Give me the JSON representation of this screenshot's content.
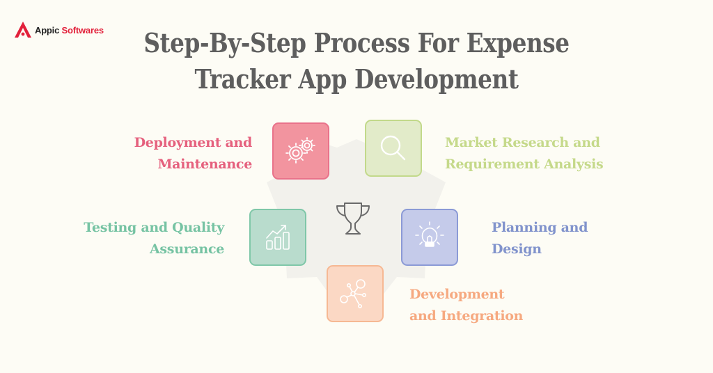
{
  "brand": {
    "name_part1": "Appic",
    "name_part2": "Softwares",
    "logo_icon": "triangle-a-logo",
    "color": "#e2203a"
  },
  "title": {
    "line1": "Step-By-Step Process For Expense",
    "line2": "Tracker App Development"
  },
  "center": {
    "icon": "trophy-icon"
  },
  "steps": [
    {
      "id": "market-research",
      "label_line1": "Market Research and",
      "label_line2": "Requirement Analysis",
      "icon": "search-icon",
      "color": "#c5d98a",
      "fill": "#e2ebc9",
      "border": "#c2d98a"
    },
    {
      "id": "planning-design",
      "label_line1": "Planning and",
      "label_line2": "Design",
      "icon": "lightbulb-icon",
      "color": "#8193cc",
      "fill": "#c5cbea",
      "border": "#8b9ad6"
    },
    {
      "id": "development-integration",
      "label_line1": "Development",
      "label_line2": "and Integration",
      "icon": "network-icon",
      "color": "#f6a980",
      "fill": "#fbd8c4",
      "border": "#f6b893"
    },
    {
      "id": "testing-qa",
      "label_line1": "Testing and Quality",
      "label_line2": "Assurance",
      "icon": "growth-chart-icon",
      "color": "#76c3a3",
      "fill": "#b9dccd",
      "border": "#7fc7a8"
    },
    {
      "id": "deployment-maintenance",
      "label_line1": "Deployment and",
      "label_line2": "Maintenance",
      "icon": "gears-icon",
      "color": "#e5607d",
      "fill": "#f2949f",
      "border": "#e9728a"
    }
  ]
}
